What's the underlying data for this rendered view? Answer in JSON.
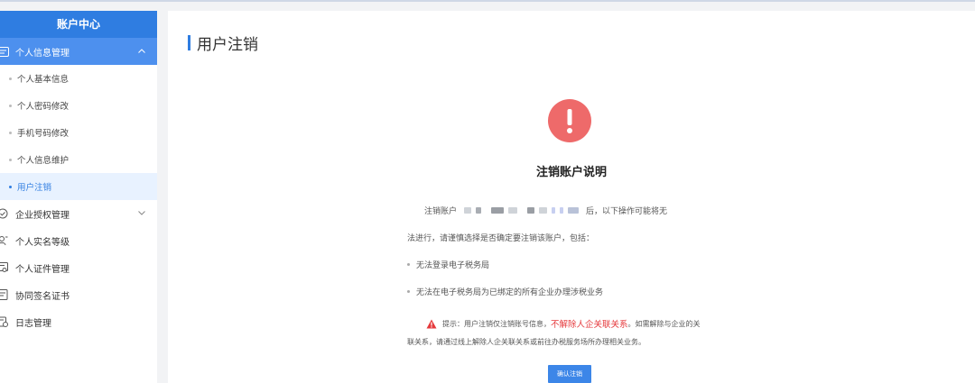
{
  "sidebar": {
    "title": "账户中心",
    "groups": [
      {
        "label": "个人信息管理",
        "icon": "id-card-icon",
        "expanded": true,
        "items": [
          {
            "label": "个人基本信息"
          },
          {
            "label": "个人密码修改"
          },
          {
            "label": "手机号码修改"
          },
          {
            "label": "个人信息维护"
          },
          {
            "label": "用户注销",
            "selected": true
          }
        ]
      },
      {
        "label": "企业授权管理",
        "icon": "check-circle-icon",
        "expanded": false
      },
      {
        "label": "个人实名等级",
        "icon": "user-level-icon"
      },
      {
        "label": "个人证件管理",
        "icon": "certificate-icon"
      },
      {
        "label": "协同签名证书",
        "icon": "document-icon"
      },
      {
        "label": "日志管理",
        "icon": "log-icon"
      }
    ]
  },
  "main": {
    "page_title": "用户注销",
    "section_title": "注销账户说明",
    "line1_prefix": "注销账户",
    "line1_suffix": "后，以下操作可能将无",
    "line2": "法进行，请谨慎选择是否确定要注销该账户，包括：",
    "bullets": [
      "无法登录电子税务局",
      "无法在电子税务局为已绑定的所有企业办理涉税业务"
    ],
    "tip_prefix": "提示：用户注销仅注销账号信息，",
    "tip_highlight": "不解除人企关联关系",
    "tip_suffix": "。如需解除与企业的关",
    "tip_line2": "联关系，请通过线上解除人企关联关系或前往办税服务场所办理相关业务。",
    "confirm_button": "确认注销"
  },
  "colors": {
    "primary": "#2f7de1",
    "danger": "#ee6a6a",
    "highlight_red": "#e5393c"
  }
}
